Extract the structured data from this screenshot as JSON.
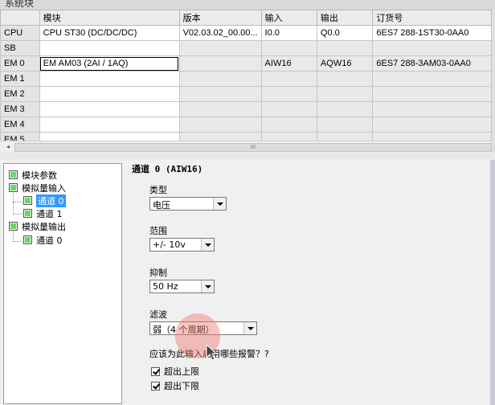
{
  "window": {
    "title": "系统块"
  },
  "table": {
    "columns": [
      "",
      "模块",
      "版本",
      "输入",
      "输出",
      "订货号"
    ],
    "rows": [
      {
        "slot": "CPU",
        "module": "CPU ST30 (DC/DC/DC)",
        "version": "V02.03.02_00.00...",
        "input": "I0.0",
        "output": "Q0.0",
        "order": "6ES7 288-1ST30-0AA0"
      },
      {
        "slot": "SB",
        "module": "",
        "version": "",
        "input": "",
        "output": "",
        "order": ""
      },
      {
        "slot": "EM 0",
        "module": "EM AM03 (2AI / 1AQ)",
        "version": "",
        "input": "AIW16",
        "output": "AQW16",
        "order": "6ES7 288-3AM03-0AA0"
      },
      {
        "slot": "EM 1",
        "module": "",
        "version": "",
        "input": "",
        "output": "",
        "order": ""
      },
      {
        "slot": "EM 2",
        "module": "",
        "version": "",
        "input": "",
        "output": "",
        "order": ""
      },
      {
        "slot": "EM 3",
        "module": "",
        "version": "",
        "input": "",
        "output": "",
        "order": ""
      },
      {
        "slot": "EM 4",
        "module": "",
        "version": "",
        "input": "",
        "output": "",
        "order": ""
      },
      {
        "slot": "EM 5",
        "module": "",
        "version": "",
        "input": "",
        "output": "",
        "order": ""
      }
    ]
  },
  "scrollbar": {
    "left_arrow": "◂",
    "grip": "III"
  },
  "tree": {
    "items": [
      {
        "label": "模块参数"
      },
      {
        "label": "模拟量输入"
      },
      {
        "label": "通道 0"
      },
      {
        "label": "通道 1"
      },
      {
        "label": "模拟量输出"
      },
      {
        "label": "通道 0"
      }
    ]
  },
  "props": {
    "heading": "通道 0 (AIW16)",
    "type_label": "类型",
    "type_value": "电压",
    "range_label": "范围",
    "range_value": "+/- 10v",
    "suppress_label": "抑制",
    "suppress_value": "50 Hz",
    "filter_label": "滤波",
    "filter_value": "弱（4 个周期）",
    "alarm_question": "应该为此输入启用哪些报警？?",
    "alarm_upper": "超出上限",
    "alarm_lower": "超出下限"
  },
  "colors": {
    "selection": "#3399ff",
    "tree_box": "#6fd36f",
    "cursor_highlight": "#f0786e"
  }
}
